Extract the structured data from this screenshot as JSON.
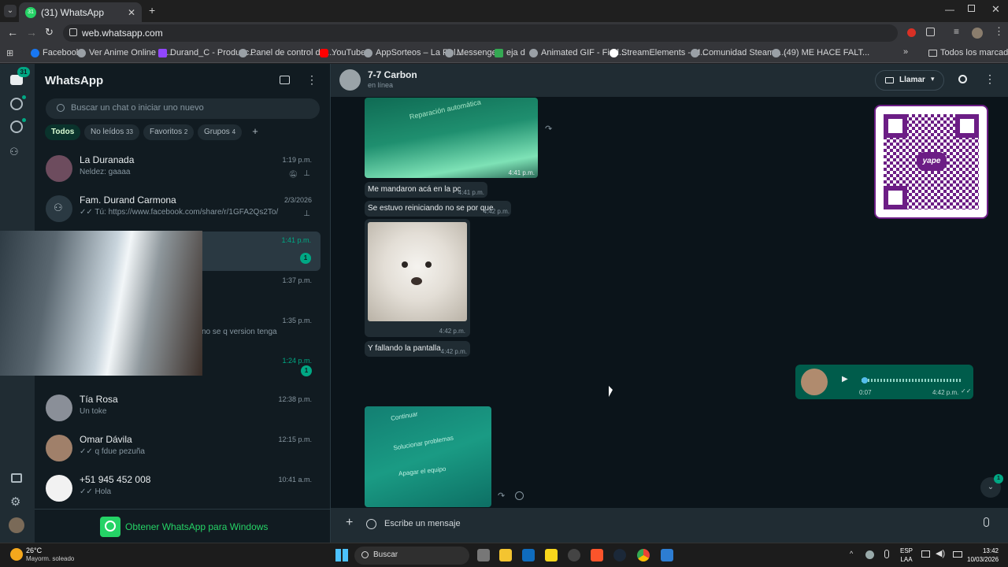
{
  "browser": {
    "tab_title": "(31) WhatsApp",
    "tab_badge": "31",
    "url": "web.whatsapp.com",
    "bookmarks": [
      {
        "label": "Facebook"
      },
      {
        "label": "Ver Anime Online S..."
      },
      {
        "label": "Durand_C - Producc..."
      },
      {
        "label": "Panel de control del..."
      },
      {
        "label": "YouTube"
      },
      {
        "label": "AppSorteos – La Rul..."
      },
      {
        "label": "Messenger"
      },
      {
        "label": "eja d"
      },
      {
        "label": "Animated GIF - Find..."
      },
      {
        "label": "StreamElements - M..."
      },
      {
        "label": "Comunidad Steam :..."
      },
      {
        "label": "(49) ME HACE FALT..."
      }
    ],
    "all_bookmarks": "Todos los marcadores"
  },
  "rail": {
    "chats_badge": "31"
  },
  "sidebar": {
    "title": "WhatsApp",
    "search_placeholder": "Buscar un chat o iniciar uno nuevo",
    "filters": [
      {
        "label": "Todos"
      },
      {
        "label": "No leídos",
        "count": "33"
      },
      {
        "label": "Favoritos",
        "count": "2"
      },
      {
        "label": "Grupos",
        "count": "4"
      }
    ],
    "add_filter": "+",
    "chats": [
      {
        "name": "La Duranada",
        "preview": "Neldez: gaaaa",
        "time": "1:19 p.m."
      },
      {
        "name": "Fam. Durand Carmona",
        "preview": "Tú: https://www.facebook.com/share/r/1GFA2Qs2To/",
        "time": "2/3/2026"
      },
      {
        "name": "",
        "preview": "",
        "time": "1:41 p.m.",
        "unread": "1"
      },
      {
        "name": "",
        "preview": "",
        "time": "1:37 p.m."
      },
      {
        "name": "",
        "preview": "no se q version tenga",
        "time": "1:35 p.m."
      },
      {
        "name": "",
        "preview": "",
        "time": "1:24 p.m.",
        "unread": "1"
      },
      {
        "name": "Tía Rosa",
        "preview": "Un toke",
        "time": "12:38 p.m."
      },
      {
        "name": "Omar Dávila",
        "preview": "q fdue pezuña",
        "time": "12:15 p.m."
      },
      {
        "name": "+51 945 452 008",
        "preview": "Hola",
        "time": "10:41 a.m."
      }
    ],
    "download_cta": "Obtener WhatsApp para Windows"
  },
  "chat": {
    "contact_name": "7-7 Carbon",
    "status": "en línea",
    "call_label": "Llamar",
    "messages": [
      {
        "kind": "image",
        "caption_time": "4:41 p.m.",
        "screen_text": "Reparación automática"
      },
      {
        "kind": "text",
        "text": "Me mandaron acá en la pc",
        "time": "4:41 p.m."
      },
      {
        "kind": "text",
        "text": "Se estuvo reiniciando no se por que",
        "time": "4:42 p.m."
      },
      {
        "kind": "image",
        "time": "4:42 p.m."
      },
      {
        "kind": "text",
        "text": "Y fallando la pantalla",
        "time": "4:42 p.m."
      },
      {
        "kind": "audio",
        "duration": "0:07",
        "time": "4:42 p.m."
      },
      {
        "kind": "image",
        "screen_lines": [
          "Continuar",
          "Solucionar problemas",
          "Apagar el equipo"
        ]
      }
    ],
    "qr_brand": "yape",
    "scroll_badge": "1",
    "composer_placeholder": "Escribe un mensaje"
  },
  "taskbar": {
    "weather_temp": "26°C",
    "weather_desc": "Mayorm. soleado",
    "search": "Buscar",
    "lang1": "ESP",
    "lang2": "LAA",
    "time": "13:42",
    "date": "10/03/2026"
  },
  "colors": {
    "wa_green": "#00a884",
    "wa_bg": "#0b141a",
    "panel": "#202c33",
    "outgoing": "#005c4b",
    "qr_purple": "#6c1d85"
  }
}
